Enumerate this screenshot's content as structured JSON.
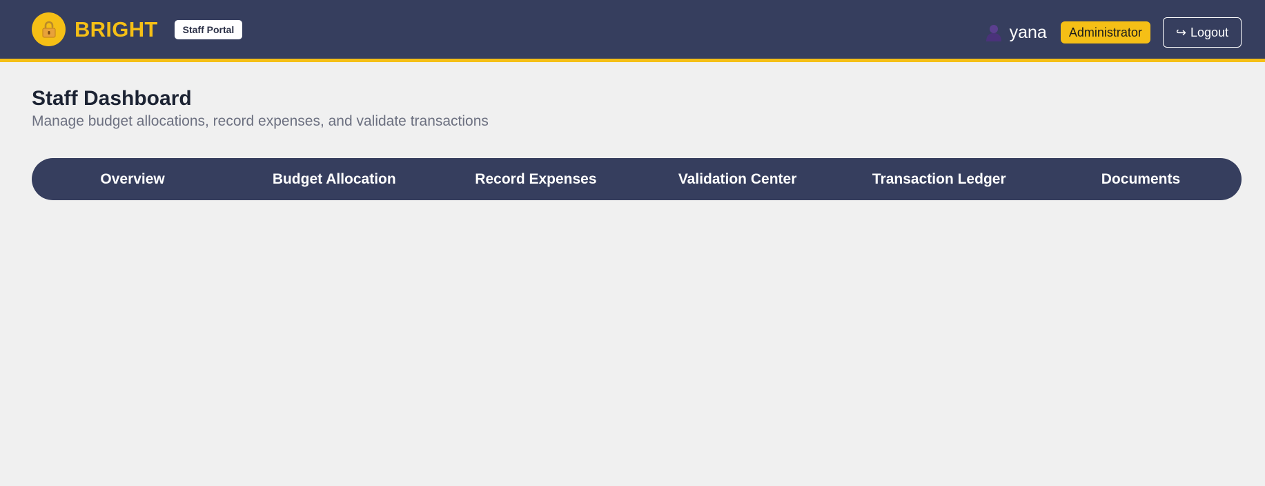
{
  "header": {
    "brand": "BRIGHT",
    "portal_badge": "Staff Portal",
    "logo_icon": "lock-icon",
    "user_icon": "person-icon",
    "username": "yana",
    "role": "Administrator",
    "logout_label": "Logout",
    "logout_icon": "logout-arrow-icon"
  },
  "page": {
    "title": "Staff Dashboard",
    "subtitle": "Manage budget allocations, record expenses, and validate transactions"
  },
  "nav": {
    "tabs": [
      {
        "label": "Overview"
      },
      {
        "label": "Budget Allocation"
      },
      {
        "label": "Record Expenses"
      },
      {
        "label": "Validation Center"
      },
      {
        "label": "Transaction Ledger"
      },
      {
        "label": "Documents"
      }
    ]
  },
  "colors": {
    "header_bg": "#363e5e",
    "accent": "#f5bf16",
    "page_bg": "#f0f0f0",
    "title_text": "#1c2333",
    "subtitle_text": "#6c7080"
  }
}
